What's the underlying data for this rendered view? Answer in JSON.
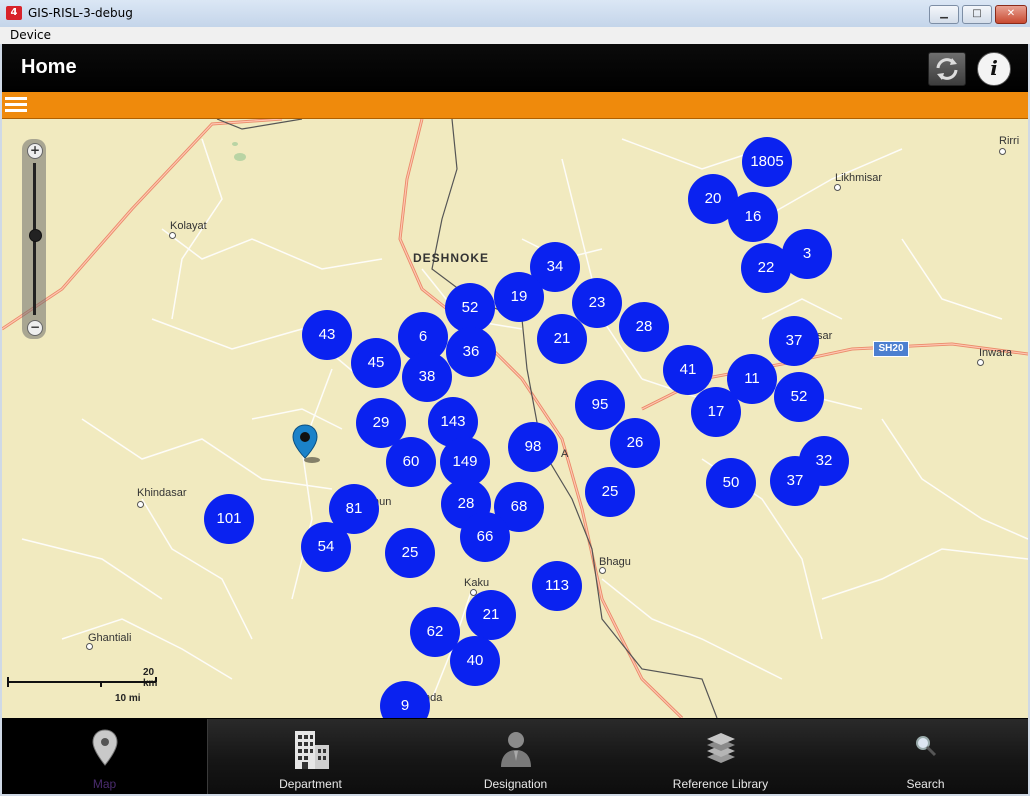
{
  "window": {
    "title": "GIS-RISL-3-debug",
    "app_badge": "4"
  },
  "menu": {
    "device": "Device"
  },
  "header": {
    "title": "Home"
  },
  "zoom": {
    "plus": "+",
    "minus": "−"
  },
  "places": [
    {
      "id": "kolayat",
      "name": "Kolayat"
    },
    {
      "id": "deshnoke",
      "name": "DESHNOKE"
    },
    {
      "id": "likhmisar",
      "name": "Likhmisar"
    },
    {
      "id": "rirri",
      "name": "Rirri"
    },
    {
      "id": "inwara",
      "name": "Inwara"
    },
    {
      "id": "khindasar",
      "name": "Khindasar"
    },
    {
      "id": "chun",
      "name": "hun"
    },
    {
      "id": "sar",
      "name": "sar"
    },
    {
      "id": "na",
      "name": "A"
    },
    {
      "id": "bhagu",
      "name": "Bhagu"
    },
    {
      "id": "kaku",
      "name": "Kaku"
    },
    {
      "id": "ghantiali",
      "name": "Ghantiali"
    },
    {
      "id": "nda",
      "name": "nda"
    }
  ],
  "road_badge": "SH20",
  "scale": {
    "km": "20 km",
    "mi": "10 mi"
  },
  "clusters": [
    "1805",
    "20",
    "16",
    "22",
    "3",
    "34",
    "52",
    "19",
    "23",
    "43",
    "6",
    "36",
    "21",
    "28",
    "37",
    "45",
    "38",
    "41",
    "11",
    "95",
    "52",
    "17",
    "29",
    "143",
    "98",
    "26",
    "60",
    "149",
    "50",
    "32",
    "37",
    "101",
    "81",
    "28",
    "68",
    "25",
    "66",
    "54",
    "25",
    "113",
    "21",
    "62",
    "40",
    "9"
  ],
  "tabs": [
    {
      "label": "Map",
      "icon": "map-pin-icon"
    },
    {
      "label": "Department",
      "icon": "building-icon"
    },
    {
      "label": "Designation",
      "icon": "person-icon"
    },
    {
      "label": "Reference Library",
      "icon": "books-icon"
    },
    {
      "label": "Search",
      "icon": "magnifier-icon"
    }
  ],
  "colors": {
    "cluster": "#0a22f0",
    "accent_bar": "#ef8a0c",
    "map_bg": "#f1eabf"
  }
}
